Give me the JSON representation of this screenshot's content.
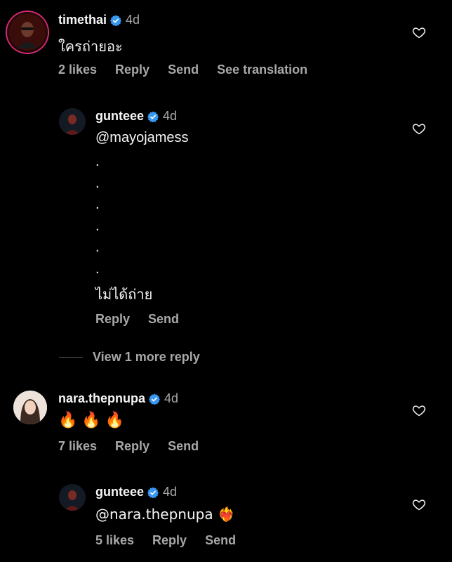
{
  "comments": [
    {
      "username": "timethai",
      "time": "4d",
      "text": "ใครถ่ายอะ",
      "likes": "2 likes",
      "reply": "Reply",
      "send": "Send",
      "translate": "See translation"
    },
    {
      "username": "gunteee",
      "time": "4d",
      "mention": "@mayojamess",
      "dots": [
        ".",
        ".",
        ".",
        ".",
        ".",
        "."
      ],
      "text": "ไม่ได้ถ่าย",
      "reply": "Reply",
      "send": "Send"
    },
    {
      "username": "nara.thepnupa",
      "time": "4d",
      "text": "🔥🔥🔥",
      "likes": "7 likes",
      "reply": "Reply",
      "send": "Send"
    },
    {
      "username": "gunteee",
      "time": "4d",
      "text": "@nara.thepnupa ❤️‍🔥",
      "likes": "5 likes",
      "reply": "Reply",
      "send": "Send"
    }
  ],
  "view_more": "View 1 more reply",
  "colors": {
    "background": "#000000",
    "verified": "#3897f0",
    "muted": "#a8a8a8",
    "text": "#f5f5f5"
  },
  "icons": {
    "verified": "verified-badge-icon",
    "like": "heart-outline-icon"
  }
}
